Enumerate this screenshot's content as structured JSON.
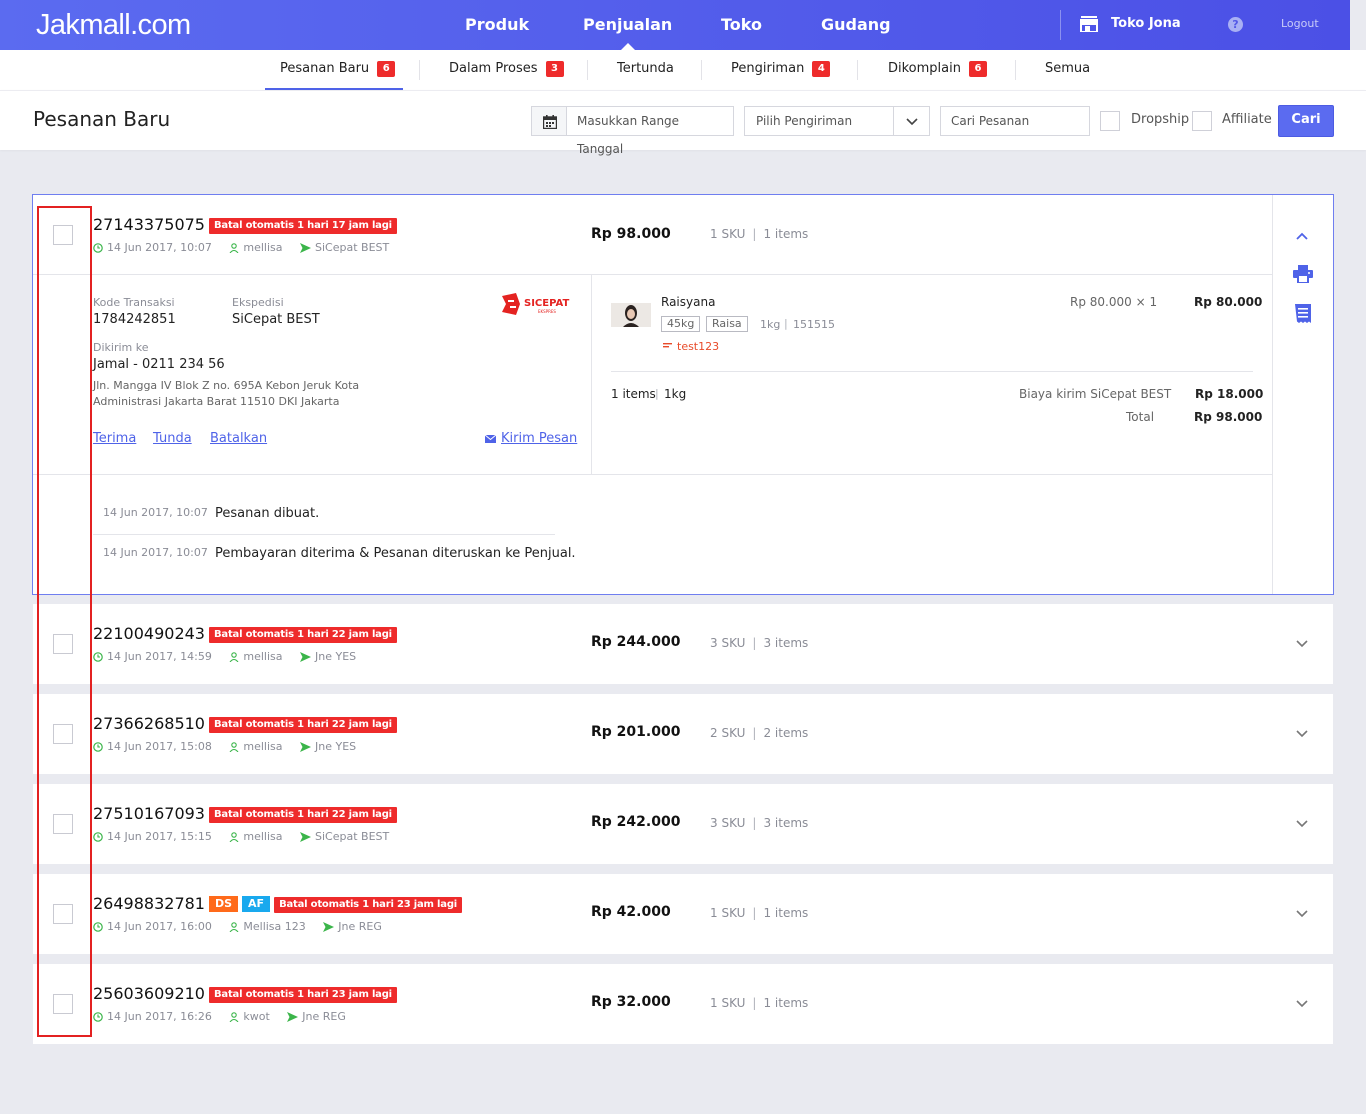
{
  "header": {
    "logo": "Jakmall.com",
    "nav": [
      "Produk",
      "Penjualan",
      "Toko",
      "Gudang"
    ],
    "active_nav": "Penjualan",
    "store_name": "Toko Jona",
    "help_label": "?",
    "logout": "Logout",
    "colors": {
      "brand": "#5b6bf0",
      "badge": "#ee2b2b"
    }
  },
  "tabs": [
    {
      "label": "Pesanan Baru",
      "count": "6"
    },
    {
      "label": "Dalam Proses",
      "count": "3"
    },
    {
      "label": "Tertunda",
      "count": ""
    },
    {
      "label": "Pengiriman",
      "count": "4"
    },
    {
      "label": "Dikomplain",
      "count": "6"
    },
    {
      "label": "Semua",
      "count": ""
    }
  ],
  "filters": {
    "page_title": "Pesanan Baru",
    "date_placeholder": "Masukkan Range Tanggal",
    "shipping_placeholder": "Pilih Pengiriman",
    "search_placeholder": "Cari Pesanan",
    "dropship_label": "Dropship",
    "affiliate_label": "Affiliate",
    "search_button": "Cari"
  },
  "orders": [
    {
      "id": "27143375075",
      "cancel_note": "Batal otomatis 1 hari 17 jam lagi",
      "datetime": "14 Jun 2017, 10:07",
      "buyer": "mellisa",
      "courier": "SiCepat BEST",
      "total": "Rp 98.000",
      "sku": "1 SKU",
      "items": "1 items"
    },
    {
      "id": "22100490243",
      "cancel_note": "Batal otomatis 1 hari 22 jam lagi",
      "datetime": "14 Jun 2017, 14:59",
      "buyer": "mellisa",
      "courier": "Jne YES",
      "total": "Rp 244.000",
      "sku": "3 SKU",
      "items": "3 items"
    },
    {
      "id": "27366268510",
      "cancel_note": "Batal otomatis 1 hari 22 jam lagi",
      "datetime": "14 Jun 2017, 15:08",
      "buyer": "mellisa",
      "courier": "Jne YES",
      "total": "Rp 201.000",
      "sku": "2 SKU",
      "items": "2 items"
    },
    {
      "id": "27510167093",
      "cancel_note": "Batal otomatis 1 hari 22 jam lagi",
      "datetime": "14 Jun 2017, 15:15",
      "buyer": "mellisa",
      "courier": "SiCepat BEST",
      "total": "Rp 242.000",
      "sku": "3 SKU",
      "items": "3 items"
    },
    {
      "id": "26498832781",
      "tag_ds": "DS",
      "tag_af": "AF",
      "cancel_note": "Batal otomatis 1 hari 23 jam lagi",
      "datetime": "14 Jun 2017, 16:00",
      "buyer": "Mellisa 123",
      "courier": "Jne REG",
      "total": "Rp 42.000",
      "sku": "1 SKU",
      "items": "1 items"
    },
    {
      "id": "25603609210",
      "cancel_note": "Batal otomatis 1 hari 23 jam lagi",
      "datetime": "14 Jun 2017, 16:26",
      "buyer": "kwot",
      "courier": "Jne REG",
      "total": "Rp 32.000",
      "sku": "1 SKU",
      "items": "1 items"
    }
  ],
  "detail": {
    "kode_label": "Kode Transaksi",
    "kode": "1784242851",
    "ekspedisi_label": "Ekspedisi",
    "ekspedisi": "SiCepat BEST",
    "courier_logo_text": "SICEPAT",
    "courier_logo_sub": "EKSPRES",
    "dikirim_label": "Dikirim ke",
    "recipient": "Jamal - 0211 234 56",
    "address_line1": "Jln. Mangga IV Blok Z no. 695A Kebon Jeruk Kota",
    "address_line2": "Administrasi Jakarta Barat 11510 DKI Jakarta",
    "actions": [
      "Terima",
      "Tunda",
      "Batalkan"
    ],
    "message_link": "Kirim Pesan",
    "product_name": "Raisyana",
    "variant_tags": [
      "45kg",
      "Raisa"
    ],
    "weight": "1kg",
    "code": "151515",
    "note": "test123",
    "unit_price": "Rp 80.000 × 1",
    "line_total": "Rp 80.000",
    "summary_items": "1 items",
    "summary_weight": "1kg",
    "shipping_label": "Biaya kirim SiCepat BEST",
    "shipping_cost": "Rp 18.000",
    "total_label": "Total",
    "total": "Rp 98.000",
    "log": [
      {
        "time": "14 Jun 2017, 10:07",
        "message": "Pesanan dibuat."
      },
      {
        "time": "14 Jun 2017, 10:07",
        "message": "Pembayaran diterima & Pesanan diteruskan ke Penjual."
      }
    ]
  }
}
